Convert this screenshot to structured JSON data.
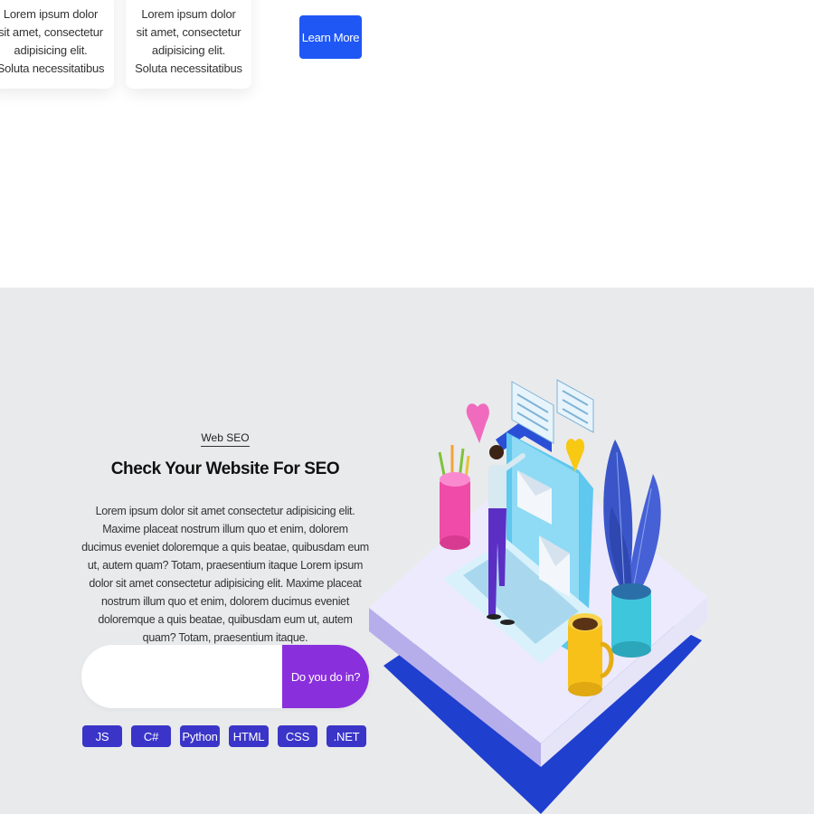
{
  "cards": [
    {
      "text": "Lorem ipsum dolor sit amet, consectetur adipisicing elit. Soluta necessitatibus"
    },
    {
      "text": "Lorem ipsum dolor sit amet, consectetur adipisicing elit. Soluta necessitatibus"
    }
  ],
  "learn_more": {
    "label": "Learn More"
  },
  "seo": {
    "kicker": "Web SEO",
    "heading": "Check Your Website For SEO",
    "paragraph": "Lorem ipsum dolor sit amet consectetur adipisicing elit. Maxime placeat nostrum illum quo et enim, dolorem ducimus eveniet doloremque a quis beatae, quibusdam eum ut, autem quam? Totam, praesentium itaque Lorem ipsum dolor sit amet consectetur adipisicing elit. Maxime placeat nostrum illum quo et enim, dolorem ducimus eveniet doloremque a quis beatae, quibusdam eum ut, autem quam? Totam, praesentium itaque.",
    "search": {
      "value": "",
      "placeholder": "",
      "button_label": "Do you do in?"
    },
    "tags": [
      "JS",
      "C#",
      "Python",
      "HTML",
      "CSS",
      ".NET"
    ]
  },
  "colors": {
    "primary_blue": "#1f57f5",
    "accent_purple": "#8a2fdc",
    "tag_indigo": "#3a35c8",
    "section_bg": "#e9eaec"
  },
  "illustration": {
    "icon": "seo-isometric-illustration-icon"
  }
}
